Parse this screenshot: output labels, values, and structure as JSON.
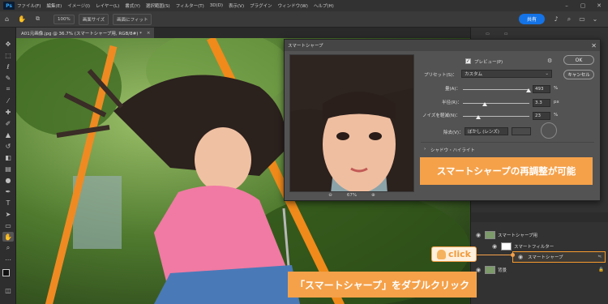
{
  "app_icon": "Ps",
  "menu": [
    "ファイル(F)",
    "編集(E)",
    "イメージ(I)",
    "レイヤー(L)",
    "書式(Y)",
    "選択範囲(S)",
    "フィルター(T)",
    "3D(D)",
    "表示(V)",
    "プラグイン",
    "ウィンドウ(W)",
    "ヘルプ(H)"
  ],
  "options": {
    "zoom": "100%",
    "fit_screen": "画面サイズ",
    "fill_screen": "画面にフィット"
  },
  "share_label": "共有",
  "doc_tab": "A01元画像.jpg @ 36.7% (スマートシャープ用, RGB/8#) *",
  "dialog": {
    "title": "スマートシャープ",
    "preview_label": "プレビュー(P)",
    "preview_checked": true,
    "ok_label": "OK",
    "cancel_label": "キャンセル",
    "preset_label": "プリセット(S)：",
    "preset_value": "カスタム",
    "amount_label": "量(A)：",
    "amount_value": "493",
    "amount_unit": "%",
    "amount_fraction": 0.986,
    "radius_label": "半径(R)：",
    "radius_value": "3.3",
    "radius_unit": "px",
    "radius_fraction": 0.33,
    "noise_label": "ノイズを軽減(N)：",
    "noise_value": "23",
    "noise_unit": "%",
    "noise_fraction": 0.23,
    "remove_label": "除去(V)：",
    "remove_value": "ぼかし (レンズ)",
    "shadow_label": "シャドウ・ハイライト",
    "zoom_value": "67%"
  },
  "layers": {
    "smart_object": "スマートシャープ用",
    "smart_filters": "スマートフィルター",
    "smart_sharpen": "スマートシャープ",
    "background": "背景"
  },
  "annotations": {
    "click": "click",
    "top_banner": "スマートシャープの再調整が可能",
    "bottom_banner": "「スマートシャープ」をダブルクリック"
  },
  "colors": {
    "accent": "#f5a14a",
    "share": "#1473e6"
  }
}
